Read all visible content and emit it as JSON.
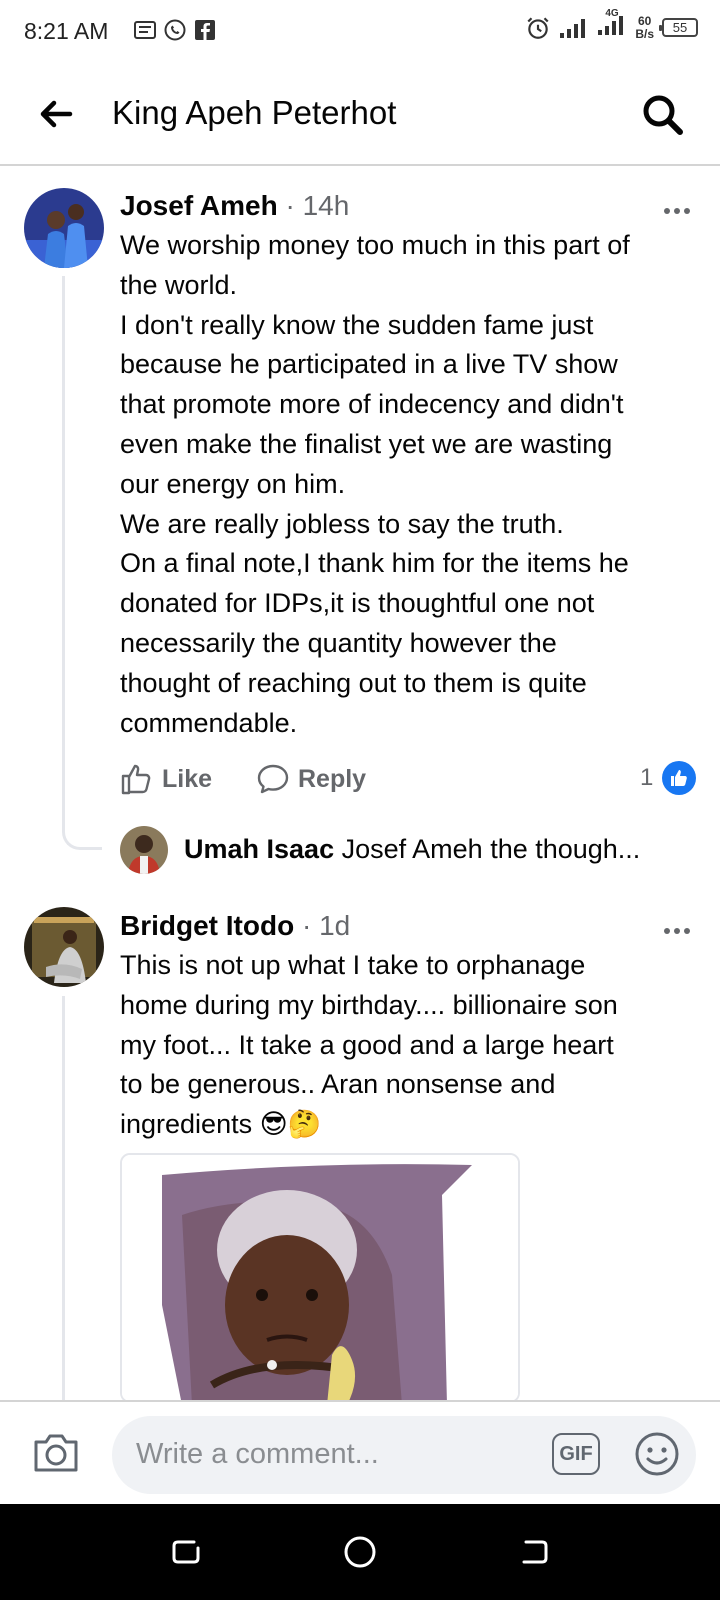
{
  "status_bar": {
    "time": "8:21 AM",
    "network_type": "4G",
    "speed_value": "60",
    "speed_unit": "B/s",
    "battery": "55"
  },
  "header": {
    "title": "King Apeh Peterhot"
  },
  "comments": [
    {
      "author": "Josef Ameh",
      "time": "14h",
      "text": "We worship money too much in this part of\nthe world.\nI don't really know the sudden fame just\nbecause he participated in a live TV show\nthat promote more of indecency and didn't\neven make the finalist yet we are wasting\nour energy on him.\nWe are really jobless to say the truth.\nOn a final note,I thank him for the items he\ndonated for IDPs,it is thoughtful one not\nnecessarily the quantity however the\nthought of reaching out to them is quite\ncommendable.",
      "like_label": "Like",
      "reply_label": "Reply",
      "reaction_count": "1",
      "reply_preview": {
        "author": "Umah Isaac",
        "text": "Josef Ameh the though..."
      }
    },
    {
      "author": "Bridget Itodo",
      "time": "1d",
      "text": "This is not up what I take to orphanage\nhome during my birthday.... billionaire son\nmy foot...   It take a good and a large heart\nto be generous.. Aran nonsense and\ningredients 😎🤔"
    }
  ],
  "composer": {
    "placeholder": "Write a comment...",
    "gif_label": "GIF"
  },
  "colors": {
    "accent": "#1877f2",
    "secondary_text": "#65676b",
    "thread_line": "#e4e6eb"
  }
}
